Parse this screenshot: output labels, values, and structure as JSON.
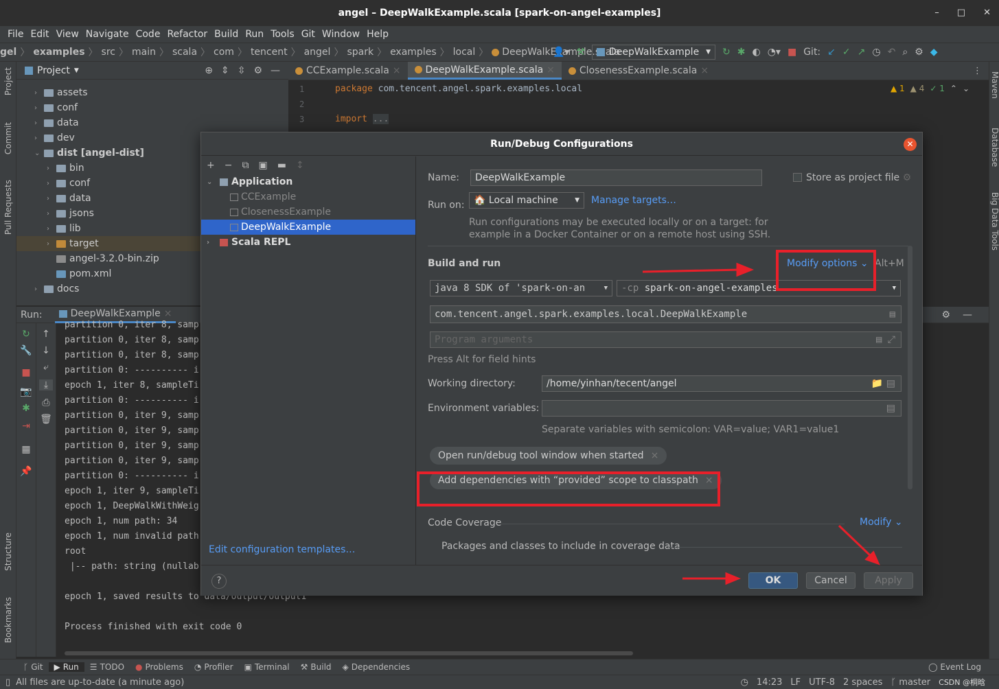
{
  "window": {
    "title": "angel – DeepWalkExample.scala [spark-on-angel-examples]",
    "controls": [
      "–",
      "□",
      "✕"
    ]
  },
  "menu": [
    "File",
    "Edit",
    "View",
    "Navigate",
    "Code",
    "Refactor",
    "Build",
    "Run",
    "Tools",
    "Git",
    "Window",
    "Help"
  ],
  "breadcrumb": [
    "gel",
    "examples",
    "src",
    "main",
    "scala",
    "com",
    "tencent",
    "angel",
    "spark",
    "examples",
    "local",
    "DeepWalkExample.scala"
  ],
  "toolbar": {
    "run_config": "DeepWalkExample",
    "git_label": "Git:"
  },
  "project": {
    "title": "Project",
    "items": [
      {
        "label": "assets",
        "depth": 1,
        "expanded": false
      },
      {
        "label": "conf",
        "depth": 1,
        "expanded": false
      },
      {
        "label": "data",
        "depth": 1,
        "expanded": false
      },
      {
        "label": "dev",
        "depth": 1,
        "expanded": false
      },
      {
        "label": "dist [angel-dist]",
        "depth": 1,
        "expanded": true
      },
      {
        "label": "bin",
        "depth": 2,
        "expanded": false
      },
      {
        "label": "conf",
        "depth": 2,
        "expanded": false
      },
      {
        "label": "data",
        "depth": 2,
        "expanded": false
      },
      {
        "label": "jsons",
        "depth": 2,
        "expanded": false
      },
      {
        "label": "lib",
        "depth": 2,
        "expanded": false
      },
      {
        "label": "target",
        "depth": 2,
        "expanded": false
      },
      {
        "label": "angel-3.2.0-bin.zip",
        "depth": 2,
        "file": true
      },
      {
        "label": "pom.xml",
        "depth": 2,
        "file": true
      },
      {
        "label": "docs",
        "depth": 1,
        "expanded": false
      }
    ]
  },
  "editor": {
    "tabs": [
      {
        "label": "CCExample.scala",
        "active": false
      },
      {
        "label": "DeepWalkExample.scala",
        "active": true
      },
      {
        "label": "ClosenessExample.scala",
        "active": false
      }
    ],
    "line_numbers": [
      "1",
      "2",
      "3"
    ],
    "code": {
      "kw1": "package",
      "pkg": "com.tencent.angel.spark.examples.local",
      "kw2": "import",
      "fold": "..."
    },
    "inspections": {
      "warnings": "1",
      "weak_warnings": "4",
      "typos": "1"
    }
  },
  "left_strip": [
    "Project",
    "Commit",
    "Pull Requests",
    "Structure",
    "Bookmarks"
  ],
  "right_strip": [
    "Maven",
    "Database",
    "Big Data Tools"
  ],
  "run": {
    "label": "Run:",
    "tab": "DeepWalkExample",
    "console": [
      "partition 0, iter 8, samp",
      "partition 0, iter 8, samp",
      "partition 0, iter 8, samp",
      "partition 0: ---------- i",
      "epoch 1, iter 8, sampleTi",
      "partition 0: ---------- i",
      "partition 0, iter 9, samp",
      "partition 0, iter 9, samp",
      "partition 0, iter 9, samp",
      "partition 0, iter 9, samp",
      "partition 0: ---------- i",
      "epoch 1, iter 9, sampleTi",
      "epoch 1, DeepWalkWithWeig",
      "epoch 1, num path: 34",
      "epoch 1, num invalid path",
      "root",
      " |-- path: string (nullab",
      "",
      "epoch 1, saved results to data/output/output1",
      "",
      "Process finished with exit code 0"
    ]
  },
  "bottom_tools": [
    "Git",
    "Run",
    "TODO",
    "Problems",
    "Profiler",
    "Terminal",
    "Build",
    "Dependencies"
  ],
  "event_log": "Event Log",
  "status": {
    "message": "All files are up-to-date (a minute ago)",
    "position": "14:23",
    "line_sep": "LF",
    "encoding": "UTF-8",
    "indent": "2 spaces",
    "branch": "master",
    "watermark": "CSDN @桐晗"
  },
  "dialog": {
    "title": "Run/Debug Configurations",
    "tree": {
      "group": "Application",
      "items": [
        "CCExample",
        "ClosenessExample",
        "DeepWalkExample"
      ],
      "selected": "DeepWalkExample",
      "group2": "Scala REPL"
    },
    "edit_templates": "Edit configuration templates…",
    "name_label": "Name:",
    "name_value": "DeepWalkExample",
    "store_label": "Store as project file",
    "store_checked": false,
    "runon_label": "Run on:",
    "runon_value": "Local machine",
    "manage_targets": "Manage targets…",
    "runon_hint1": "Run configurations may be executed locally or on a target: for",
    "runon_hint2": "example in a Docker Container or on a remote host using SSH.",
    "build_run": "Build and run",
    "modify_options": "Modify options",
    "modify_shortcut": "Alt+M",
    "sdk": "java 8 SDK of 'spark-on-an",
    "cp_prefix": "-cp",
    "cp_value": "spark-on-angel-examples",
    "main_class": "com.tencent.angel.spark.examples.local.DeepWalkExample",
    "program_args_placeholder": "Program arguments",
    "alt_hint": "Press Alt for field hints",
    "workdir_label": "Working directory:",
    "workdir_value": "/home/yinhan/tecent/angel",
    "env_label": "Environment variables:",
    "env_value": "",
    "env_hint": "Separate variables with semicolon: VAR=value; VAR1=value1",
    "chips": [
      "Open run/debug tool window when started",
      "Add dependencies with “provided” scope to classpath"
    ],
    "coverage_label": "Code Coverage",
    "coverage_modify": "Modify",
    "coverage_packages": "Packages and classes to include in coverage data",
    "help": "?",
    "ok": "OK",
    "cancel": "Cancel",
    "apply": "Apply"
  },
  "colors": {
    "accent": "#589df6",
    "selection": "#2f65ca",
    "annotation": "#e8202a",
    "ok_button": "#365880"
  }
}
